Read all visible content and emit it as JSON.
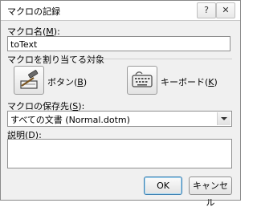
{
  "window": {
    "title": "マクロの記録",
    "help_glyph": "?",
    "close_glyph": "✕"
  },
  "macro_name": {
    "label": "マクロ名(",
    "label_key": "M",
    "label_suffix": "):",
    "value": "toText"
  },
  "assign": {
    "group_label": "マクロを割り当てる対象",
    "button_label": "ボタン(",
    "button_key": "B",
    "button_suffix": ")",
    "keyboard_label": "キーボード(",
    "keyboard_key": "K",
    "keyboard_suffix": ")"
  },
  "store": {
    "label": "マクロの保存先(",
    "label_key": "S",
    "label_suffix": "):",
    "selected": "すべての文書 (Normal.dotm)"
  },
  "description": {
    "label": "説明(",
    "label_key": "D",
    "label_suffix": "):",
    "value": ""
  },
  "footer": {
    "ok_label": "OK",
    "cancel_label": "キャンセル"
  }
}
